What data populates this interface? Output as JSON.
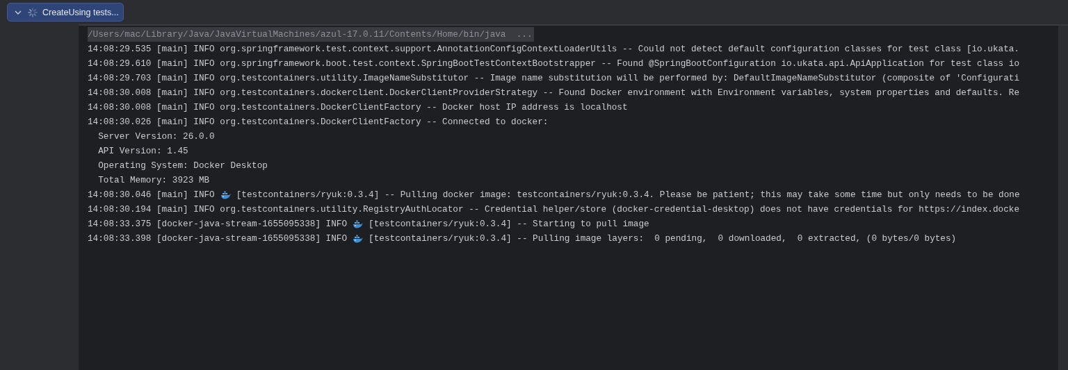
{
  "run_tab": {
    "expanded": true,
    "label": "CreateUsing tests..."
  },
  "console": {
    "command": "/Users/mac/Library/Java/JavaVirtualMachines/azul-17.0.11/Contents/Home/bin/java  ...",
    "lines": [
      {
        "kind": "plain",
        "text": "14:08:29.535 [main] INFO org.springframework.test.context.support.AnnotationConfigContextLoaderUtils -- Could not detect default configuration classes for test class [io.ukata."
      },
      {
        "kind": "plain",
        "text": "14:08:29.610 [main] INFO org.springframework.boot.test.context.SpringBootTestContextBootstrapper -- Found @SpringBootConfiguration io.ukata.api.ApiApplication for test class io"
      },
      {
        "kind": "plain",
        "text": "14:08:29.703 [main] INFO org.testcontainers.utility.ImageNameSubstitutor -- Image name substitution will be performed by: DefaultImageNameSubstitutor (composite of 'Configurati"
      },
      {
        "kind": "plain",
        "text": "14:08:30.008 [main] INFO org.testcontainers.dockerclient.DockerClientProviderStrategy -- Found Docker environment with Environment variables, system properties and defaults. Re"
      },
      {
        "kind": "plain",
        "text": "14:08:30.008 [main] INFO org.testcontainers.DockerClientFactory -- Docker host IP address is localhost"
      },
      {
        "kind": "plain",
        "text": "14:08:30.026 [main] INFO org.testcontainers.DockerClientFactory -- Connected to docker:"
      },
      {
        "kind": "plain",
        "text": "  Server Version: 26.0.0"
      },
      {
        "kind": "plain",
        "text": "  API Version: 1.45"
      },
      {
        "kind": "plain",
        "text": "  Operating System: Docker Desktop"
      },
      {
        "kind": "plain",
        "text": "  Total Memory: 3923 MB"
      },
      {
        "kind": "whale",
        "prefix": "14:08:30.046 [main] INFO",
        "text": "[testcontainers/ryuk:0.3.4] -- Pulling docker image: testcontainers/ryuk:0.3.4. Please be patient; this may take some time but only needs to be done"
      },
      {
        "kind": "plain",
        "text": "14:08:30.194 [main] INFO org.testcontainers.utility.RegistryAuthLocator -- Credential helper/store (docker-credential-desktop) does not have credentials for https://index.docke"
      },
      {
        "kind": "whale",
        "prefix": "14:08:33.375 [docker-java-stream-1655095338] INFO",
        "text": "[testcontainers/ryuk:0.3.4] -- Starting to pull image"
      },
      {
        "kind": "whale",
        "prefix": "14:08:33.398 [docker-java-stream-1655095338] INFO",
        "text": "[testcontainers/ryuk:0.3.4] -- Pulling image layers:  0 pending,  0 downloaded,  0 extracted, (0 bytes/0 bytes)"
      }
    ]
  }
}
